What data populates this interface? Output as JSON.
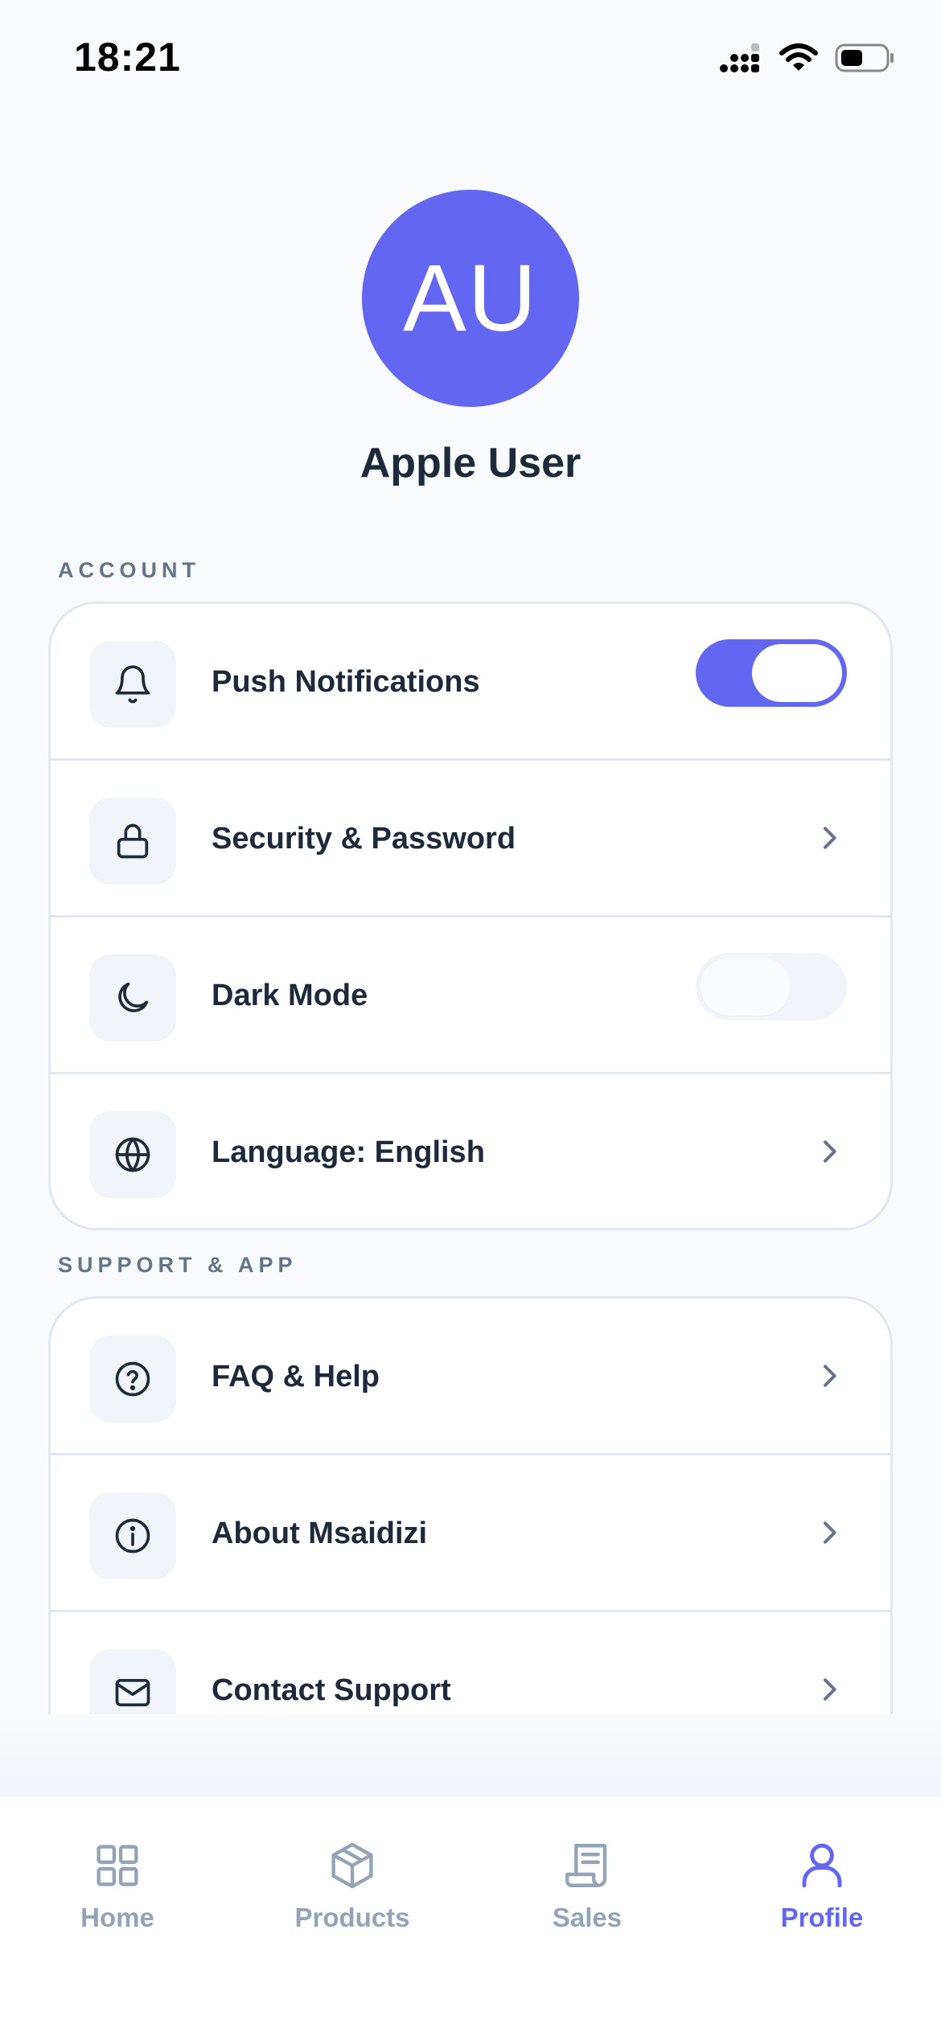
{
  "status_bar": {
    "time": "18:21"
  },
  "profile": {
    "initials": "AU",
    "name": "Apple User",
    "avatar_color": "#6366f1"
  },
  "sections": {
    "account": {
      "label": "ACCOUNT",
      "items": [
        {
          "label": "Push Notifications",
          "icon": "bell-icon",
          "control": "toggle",
          "toggle_on": true
        },
        {
          "label": "Security & Password",
          "icon": "lock-icon",
          "control": "chevron"
        },
        {
          "label": "Dark Mode",
          "icon": "moon-icon",
          "control": "toggle",
          "toggle_on": false
        },
        {
          "label": "Language: English",
          "icon": "globe-icon",
          "control": "chevron"
        }
      ]
    },
    "support": {
      "label": "SUPPORT & APP",
      "items": [
        {
          "label": "FAQ & Help",
          "icon": "help-circle-icon",
          "control": "chevron"
        },
        {
          "label": "About Msaidizi",
          "icon": "info-icon",
          "control": "chevron"
        },
        {
          "label": "Contact Support",
          "icon": "mail-icon",
          "control": "chevron"
        }
      ]
    }
  },
  "tab_bar": {
    "tabs": [
      {
        "label": "Home",
        "icon": "grid-icon",
        "active": false
      },
      {
        "label": "Products",
        "icon": "box-icon",
        "active": false
      },
      {
        "label": "Sales",
        "icon": "receipt-icon",
        "active": false
      },
      {
        "label": "Profile",
        "icon": "user-icon",
        "active": true
      }
    ]
  },
  "colors": {
    "accent": "#6366f1",
    "text": "#1e293b",
    "muted": "#94a3b8",
    "section_label": "#64748b"
  }
}
